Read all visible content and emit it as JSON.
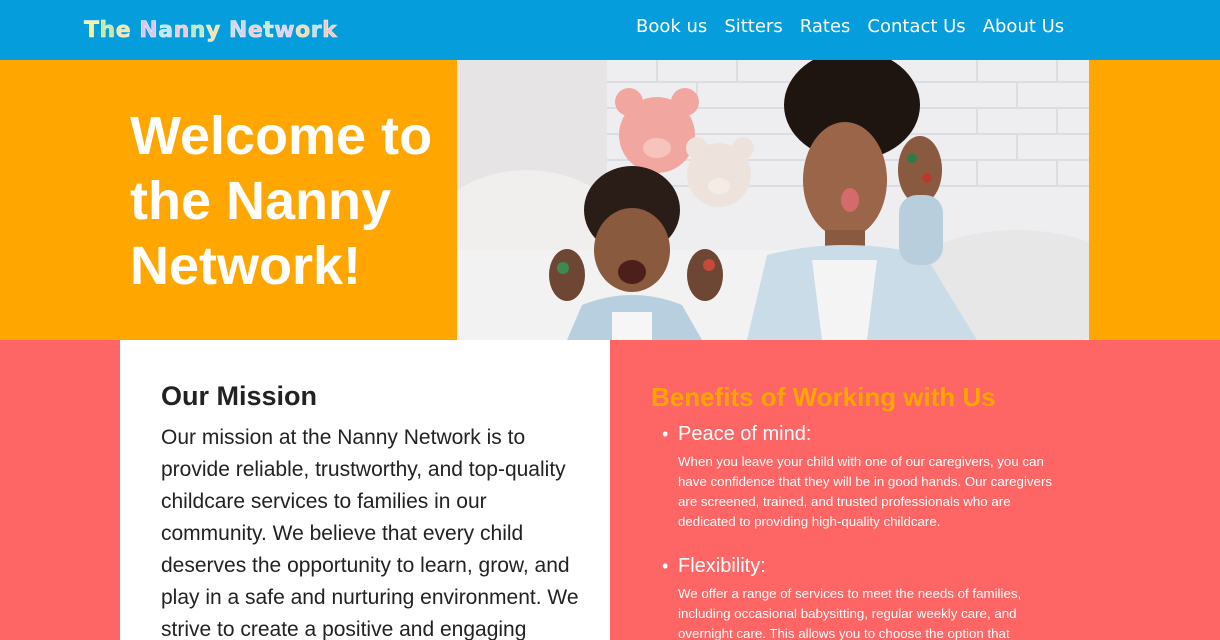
{
  "header": {
    "logo_text": "The Nanny Network",
    "logo_letters": [
      {
        "ch": "T",
        "color": "#f7f1a0"
      },
      {
        "ch": "h",
        "color": "#c8e9a6"
      },
      {
        "ch": "e",
        "color": "#fbe3a1"
      },
      {
        "ch": " ",
        "color": "#ffffff"
      },
      {
        "ch": "N",
        "color": "#d9c7ef"
      },
      {
        "ch": "a",
        "color": "#c5e6f4"
      },
      {
        "ch": "n",
        "color": "#f4c7d8"
      },
      {
        "ch": "n",
        "color": "#bfe7c5"
      },
      {
        "ch": "y",
        "color": "#f6e4a6"
      },
      {
        "ch": " ",
        "color": "#ffffff"
      },
      {
        "ch": "N",
        "color": "#cfd7f4"
      },
      {
        "ch": "e",
        "color": "#f4cbd1"
      },
      {
        "ch": "t",
        "color": "#c6ecd8"
      },
      {
        "ch": "w",
        "color": "#e2cdf3"
      },
      {
        "ch": "o",
        "color": "#f5dbaa"
      },
      {
        "ch": "r",
        "color": "#bfe3f2"
      },
      {
        "ch": "k",
        "color": "#f2c8c2"
      }
    ],
    "nav": {
      "book": "Book us",
      "sitters": "Sitters",
      "rates": "Rates",
      "contact": "Contact Us",
      "about": "About Us"
    }
  },
  "hero": {
    "title": "Welcome to the Nanny Network!"
  },
  "mission": {
    "title": "Our Mission",
    "text": "Our mission at the Nanny Network is to provide reliable, trustworthy, and top-quality childcare services to families in our community. We believe that every child deserves the opportunity to learn, grow, and play in a safe and nurturing environment. We strive to create a positive and engaging"
  },
  "benefits": {
    "title": "Benefits of Working with Us",
    "items": [
      {
        "heading": "Peace of mind:",
        "body": "When you leave your child with one of our caregivers, you can have confidence that they will be in good hands. Our caregivers are screened, trained, and trusted professionals who are dedicated to providing high-quality childcare."
      },
      {
        "heading": "Flexibility:",
        "body": "We offer a range of services to meet the needs of families, including occasional babysitting, regular weekly care, and overnight care. This allows you to choose the option that"
      }
    ]
  },
  "colors": {
    "header_bg": "#069ddd",
    "hero_bg": "#ffa600",
    "coral": "#fe6565",
    "accent_orange": "#ffa600"
  }
}
